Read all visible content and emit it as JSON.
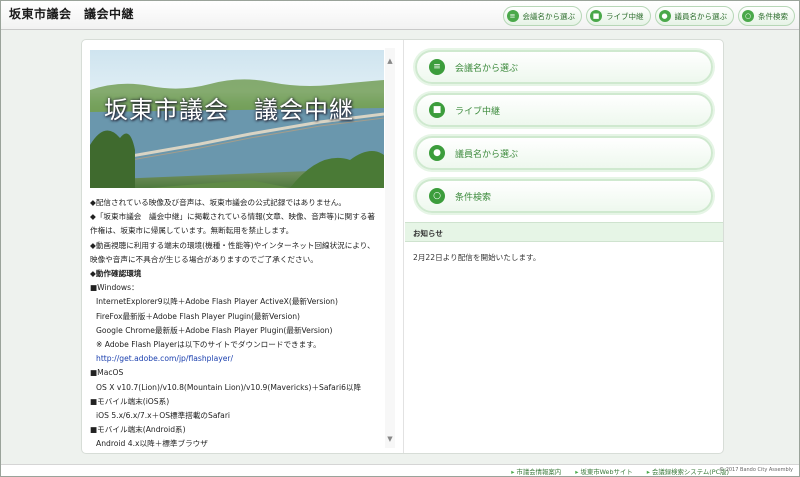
{
  "header": {
    "title": "坂東市議会　議会中継",
    "nav": [
      {
        "icon": "list-icon",
        "label": "会議名から選ぶ"
      },
      {
        "icon": "video-camera-icon",
        "label": "ライブ中継"
      },
      {
        "icon": "person-icon",
        "label": "議員名から選ぶ"
      },
      {
        "icon": "search-icon",
        "label": "条件検索"
      }
    ]
  },
  "hero": {
    "title": "坂東市議会　議会中継"
  },
  "notice": {
    "lines": [
      "◆配信されている映像及び音声は、坂東市議会の公式記録ではありません。",
      "◆「坂東市議会　議会中継」に掲載されている情報(文章、映像、音声等)に関する著",
      "作権は、坂東市に帰属しています。無断転用を禁止します。",
      "◆動画視聴に利用する端末の環境(機種・性能等)やインターネット回線状況により、",
      "映像や音声に不具合が生じる場合がありますのでご了承ください。"
    ],
    "env_title": "◆動作確認環境",
    "windows_title": "■Windows：",
    "windows_items": [
      "InternetExplorer9以降＋Adobe Flash Player ActiveX(最新Version)",
      "FireFox最新版＋Adobe Flash Player Plugin(最新Version)",
      "Google Chrome最新版＋Adobe Flash Player Plugin(最新Version)",
      "※ Adobe Flash Playerは以下のサイトでダウンロードできます。"
    ],
    "flash_link": "http://get.adobe.com/jp/flashplayer/",
    "mac_title": "■MacOS",
    "mac_item": "OS X v10.7(Lion)/v10.8(Mountain Lion)/v10.9(Mavericks)＋Safari6以降",
    "ios_title": "■モバイル端末(iOS系)",
    "ios_item": "iOS 5.x/6.x/7.x＋OS標準搭載のSafari",
    "android_title": "■モバイル端末(Android系)",
    "android_item": "Android 4.x以降＋標準ブラウザ"
  },
  "menu": [
    {
      "icon": "list-icon",
      "label": "会議名から選ぶ"
    },
    {
      "icon": "video-camera-icon",
      "label": "ライブ中継"
    },
    {
      "icon": "person-icon",
      "label": "議員名から選ぶ"
    },
    {
      "icon": "search-icon",
      "label": "条件検索"
    }
  ],
  "news": {
    "heading": "お知らせ",
    "body": "2月22日より配信を開始いたします。"
  },
  "footer": {
    "links": [
      "市議会情報案内",
      "坂東市Webサイト",
      "会議録検索システム(PC版)"
    ],
    "copyright": "© 2017 Bando City Assembly"
  },
  "colors": {
    "accent": "#3c9d3c",
    "header_news": "#e6f5e6"
  }
}
